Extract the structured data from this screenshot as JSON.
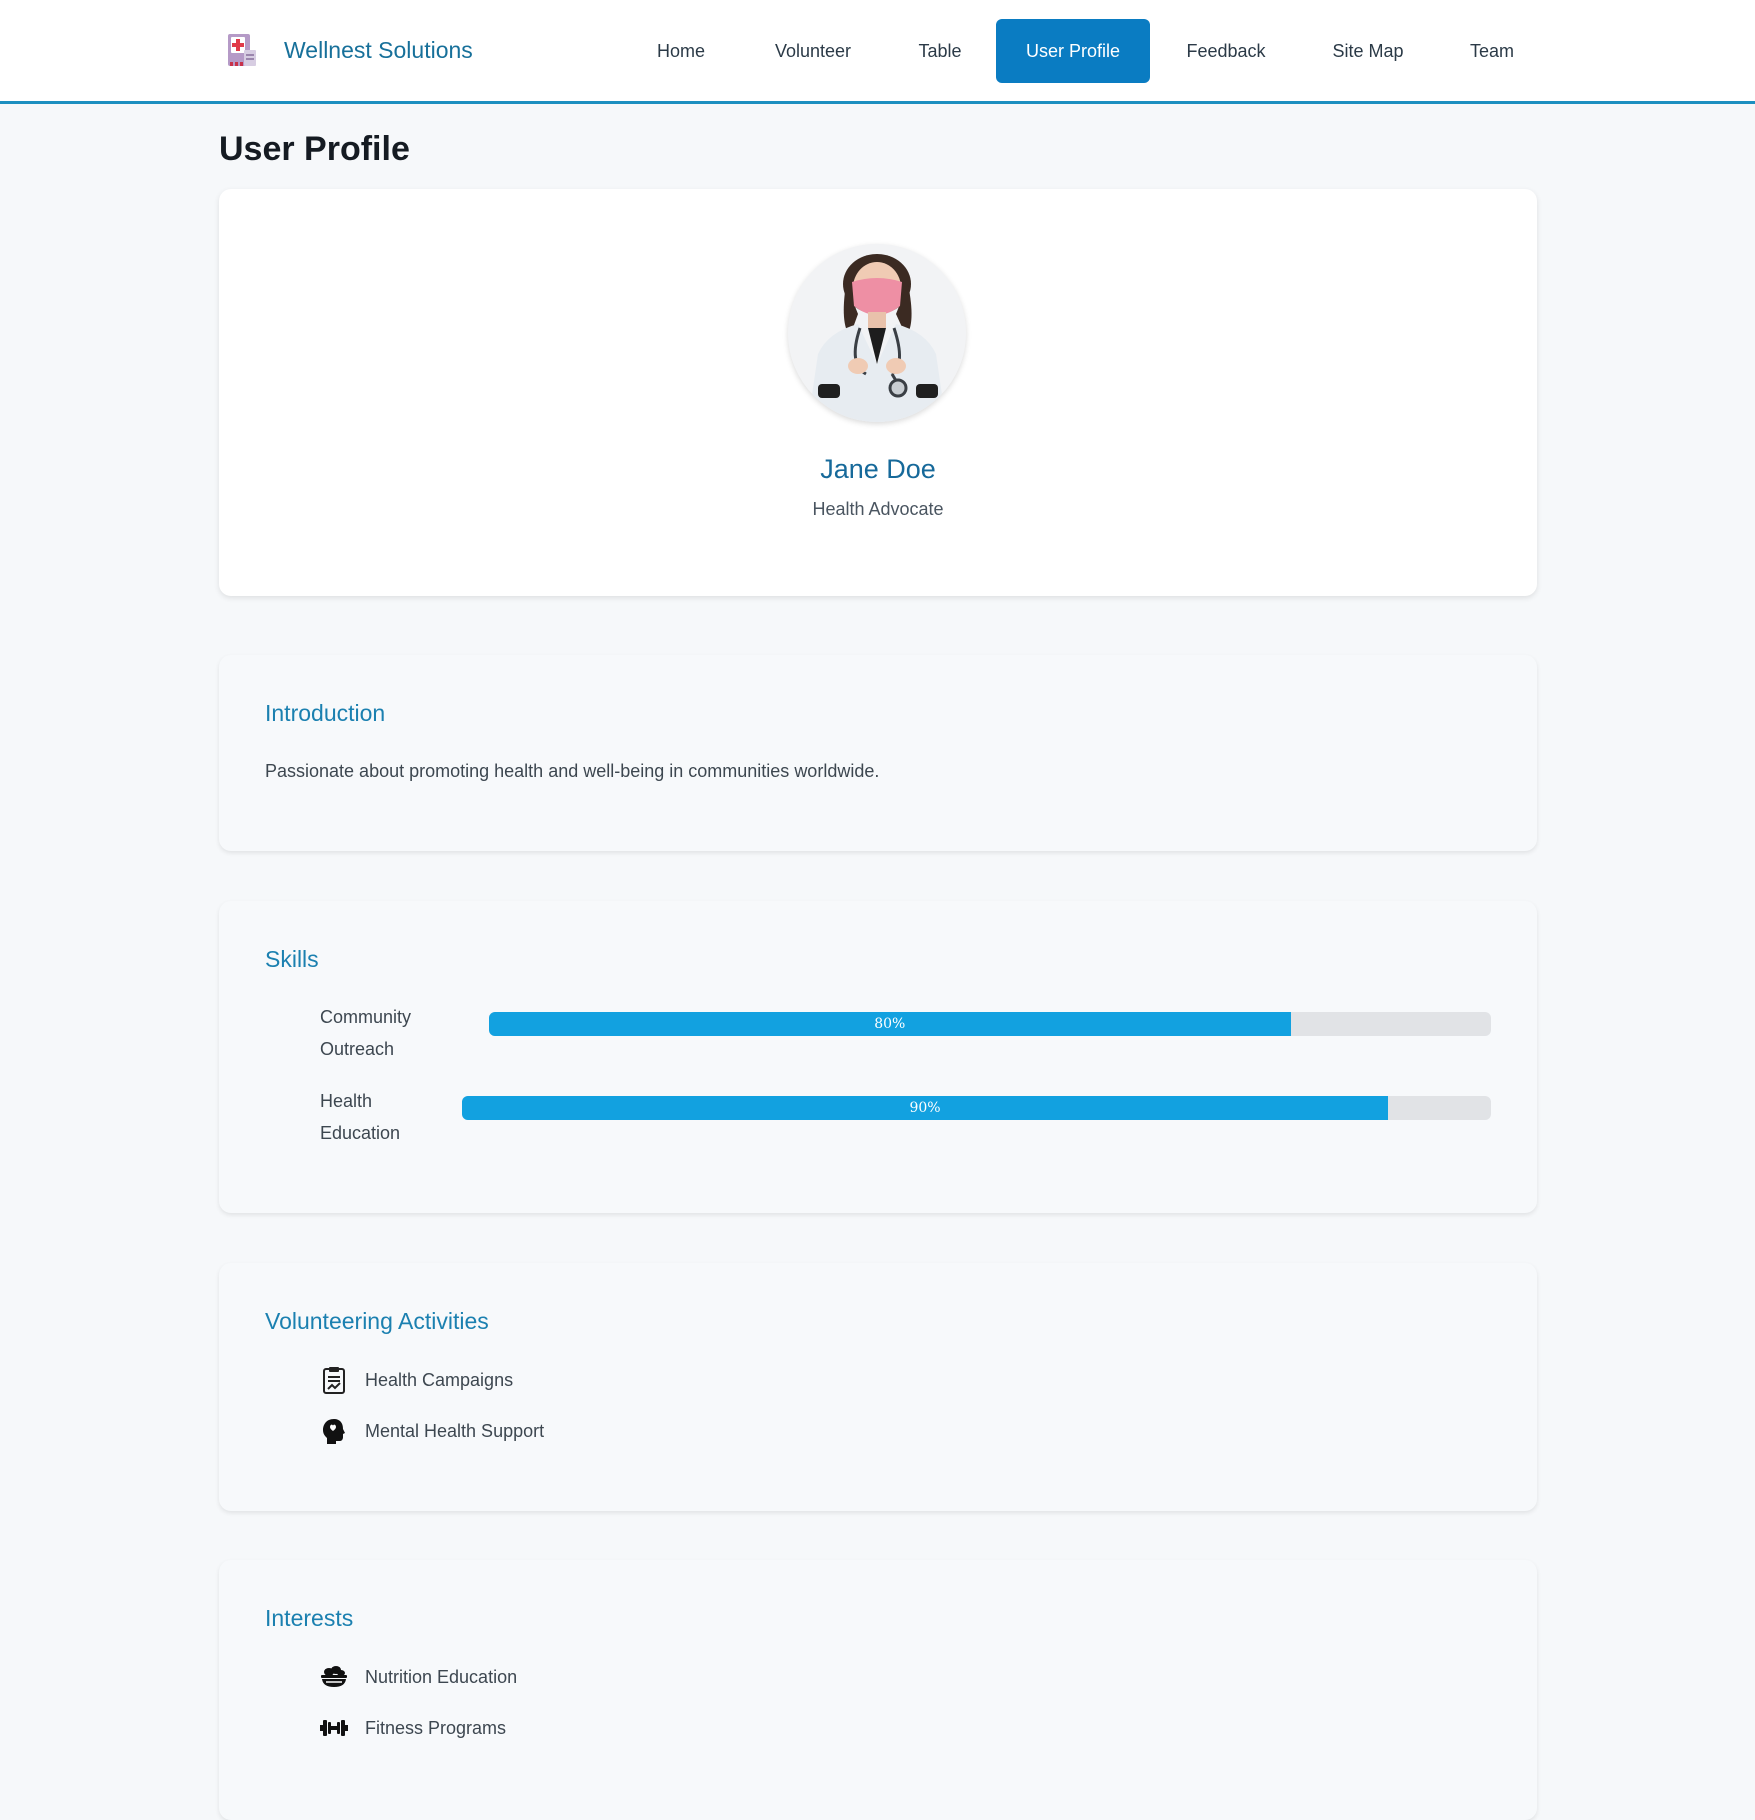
{
  "brand": {
    "name": "Wellnest Solutions",
    "logo_icon": "medical-logo-icon"
  },
  "nav": {
    "items": [
      {
        "label": "Home",
        "active": false
      },
      {
        "label": "Volunteer",
        "active": false
      },
      {
        "label": "Table",
        "active": false
      },
      {
        "label": "User Profile",
        "active": true
      },
      {
        "label": "Feedback",
        "active": false
      },
      {
        "label": "Site Map",
        "active": false
      },
      {
        "label": "Team",
        "active": false
      }
    ]
  },
  "page": {
    "title": "User Profile"
  },
  "profile": {
    "name": "Jane Doe",
    "role": "Health Advocate"
  },
  "introduction": {
    "title": "Introduction",
    "text": "Passionate about promoting health and well-being in communities worldwide."
  },
  "skills": {
    "title": "Skills",
    "items": [
      {
        "label_line1": "Community",
        "label_line2": "Outreach",
        "percent": 80,
        "percent_label": "80%"
      },
      {
        "label_line1": "Health",
        "label_line2": "Education",
        "percent": 90,
        "percent_label": "90%"
      }
    ]
  },
  "volunteering": {
    "title": "Volunteering Activities",
    "items": [
      {
        "label": "Health Campaigns",
        "icon": "clipboard-chart-icon"
      },
      {
        "label": "Mental Health Support",
        "icon": "head-heart-icon"
      }
    ]
  },
  "interests": {
    "title": "Interests",
    "items": [
      {
        "label": "Nutrition Education",
        "icon": "food-bowl-icon"
      },
      {
        "label": "Fitness Programs",
        "icon": "dumbbell-icon"
      }
    ]
  },
  "colors": {
    "accent": "#0a7cc2",
    "heading": "#1b80b0",
    "bar_fill": "#12a1e0",
    "bar_track": "#e1e3e6"
  }
}
